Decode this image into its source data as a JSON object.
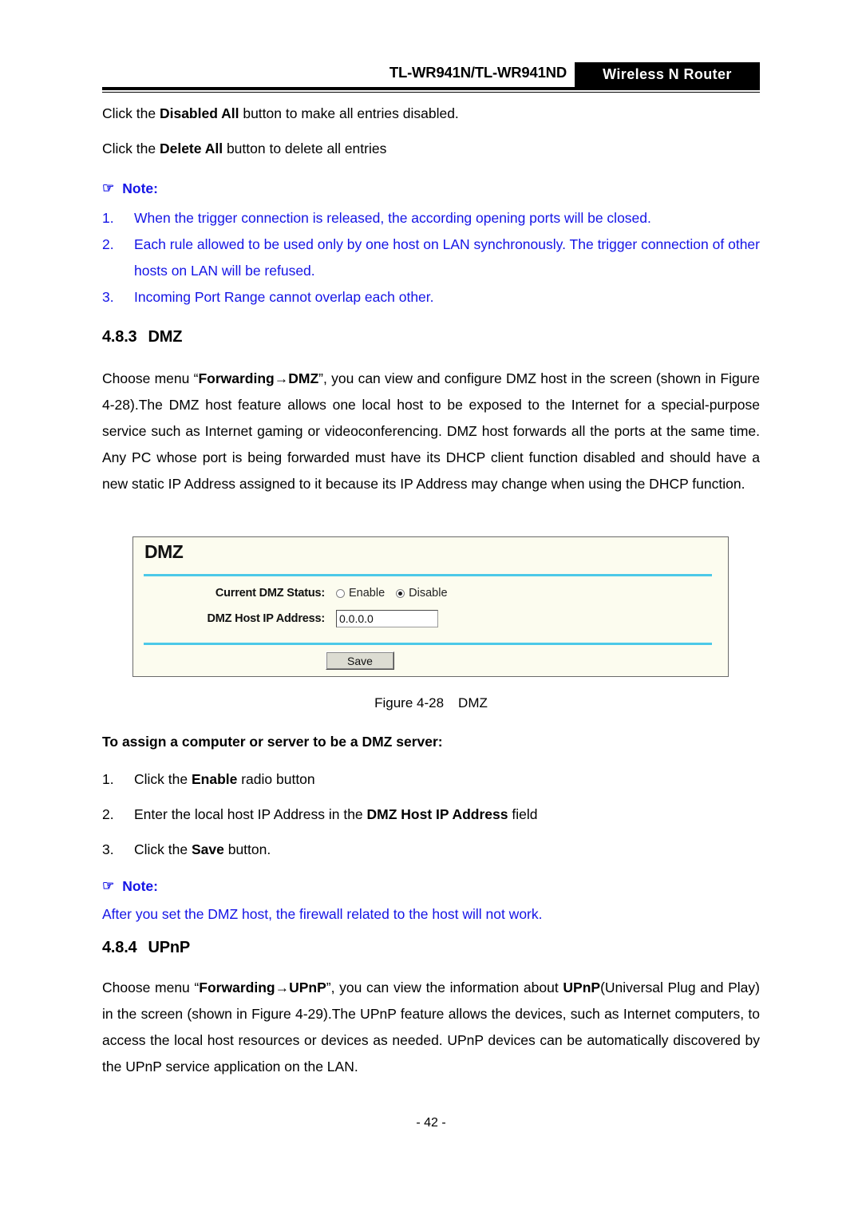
{
  "header": {
    "model": "TL-WR941N/TL-WR941ND",
    "badge": "Wireless N Router"
  },
  "intro": {
    "line1_pre": "Click the ",
    "line1_bold": "Disabled All",
    "line1_post": " button to make all entries disabled.",
    "line2_pre": "Click the ",
    "line2_bold": "Delete All",
    "line2_post": " button to delete all entries"
  },
  "note1": {
    "icon": "pointing-hand-icon",
    "label": "Note:",
    "items": [
      {
        "num": "1.",
        "text": "When the trigger connection is released, the according opening ports will be closed."
      },
      {
        "num": "2.",
        "text": "Each rule allowed to be used only by one host on LAN synchronously. The trigger connection of other hosts on LAN will be refused."
      },
      {
        "num": "3.",
        "text": "Incoming Port Range cannot overlap each other."
      }
    ]
  },
  "section_dmz": {
    "number": "4.8.3",
    "title": "DMZ",
    "para_part1": "Choose menu “",
    "para_bold1": "Forwarding",
    "para_arrow": "→",
    "para_bold2": "DMZ",
    "para_part2": "”, you can view and configure DMZ host in the screen (shown in Figure 4-28).The DMZ host feature allows one local host to be exposed to the Internet for a special-purpose service such as Internet gaming or videoconferencing. DMZ host forwards all the ports at the same time. Any PC whose port is being forwarded must have its DHCP client function disabled and should have a new static IP Address assigned to it because its IP Address may change when using the DHCP function."
  },
  "screenshot": {
    "title": "DMZ",
    "status_label": "Current DMZ Status:",
    "radio_enable": "Enable",
    "radio_disable": "Disable",
    "selected_radio": "Disable",
    "ip_label": "DMZ Host IP Address:",
    "ip_value": "0.0.0.0",
    "save_label": "Save",
    "accent_rule_color": "#4cc9e8",
    "panel_background": "#fcfcef"
  },
  "figure": {
    "label": "Figure 4-28",
    "name": "DMZ"
  },
  "assign": {
    "heading": "To assign a computer or server to be a DMZ server:",
    "steps": [
      {
        "num": "1.",
        "pre": "Click the ",
        "bold": "Enable",
        "post": " radio button"
      },
      {
        "num": "2.",
        "pre": "Enter the local host IP Address in the ",
        "bold": "DMZ Host IP Address",
        "post": " field"
      },
      {
        "num": "3.",
        "pre": "Click the ",
        "bold": "Save",
        "post": " button."
      }
    ]
  },
  "note2": {
    "icon": "pointing-hand-icon",
    "label": "Note:",
    "text": "After you set the DMZ host, the firewall related to the host will not work."
  },
  "section_upnp": {
    "number": "4.8.4",
    "title": "UPnP",
    "para_part1": "Choose menu “",
    "para_bold1": "Forwarding",
    "para_arrow": "→",
    "para_bold2": "UPnP",
    "para_part2": "”, you can view the information about ",
    "para_bold3": "UPnP",
    "para_part3": "(Universal Plug and Play) in the screen (shown in Figure 4-29).The UPnP feature allows the devices, such as Internet computers, to access the local host resources or devices as needed. UPnP devices can be automatically discovered by the UPnP service application on the LAN."
  },
  "footer": {
    "page_number": "- 42 -"
  }
}
